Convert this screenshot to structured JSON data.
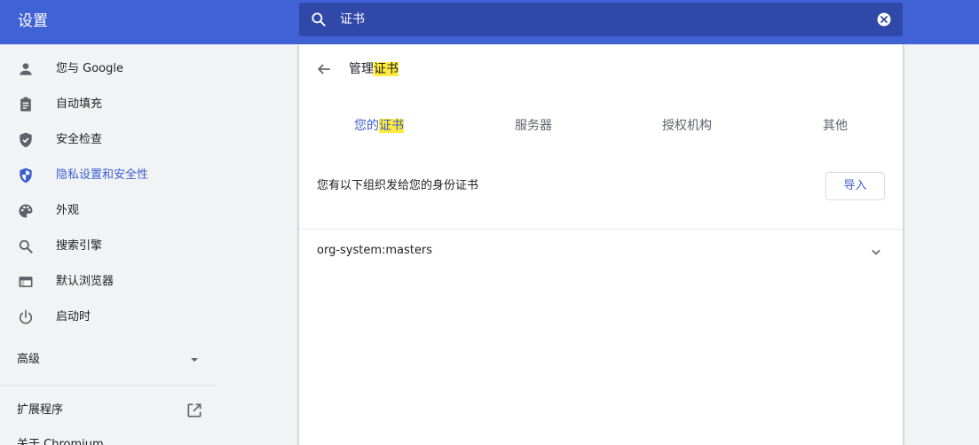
{
  "header": {
    "title": "设置",
    "search_value": "证书"
  },
  "sidebar": {
    "items": [
      {
        "label": "您与 Google",
        "icon": "person-icon"
      },
      {
        "label": "自动填充",
        "icon": "clipboard-icon"
      },
      {
        "label": "安全检查",
        "icon": "shield-check-icon"
      },
      {
        "label": "隐私设置和安全性",
        "icon": "shield-half-icon",
        "active": true
      },
      {
        "label": "外观",
        "icon": "palette-icon"
      },
      {
        "label": "搜索引擎",
        "icon": "search-icon"
      },
      {
        "label": "默认浏览器",
        "icon": "browser-window-icon"
      },
      {
        "label": "启动时",
        "icon": "power-icon"
      }
    ],
    "advanced_label": "高级",
    "extensions_label": "扩展程序",
    "about_label": "关于 Chromium"
  },
  "main": {
    "title_prefix": "管理",
    "title_highlight": "证书",
    "tabs": [
      {
        "prefix": "您的",
        "highlight": "证书",
        "active": true
      },
      {
        "label": "服务器"
      },
      {
        "label": "授权机构"
      },
      {
        "label": "其他"
      }
    ],
    "description": "您有以下组织发给您的身份证书",
    "import_button": "导入",
    "org_name": "org-system:masters"
  },
  "colors": {
    "header_bg": "#4162d6",
    "search_bg": "#3048a8",
    "accent": "#3b5fd3",
    "highlight": "#ffeb3b",
    "page_bg": "#f1f3f4"
  }
}
